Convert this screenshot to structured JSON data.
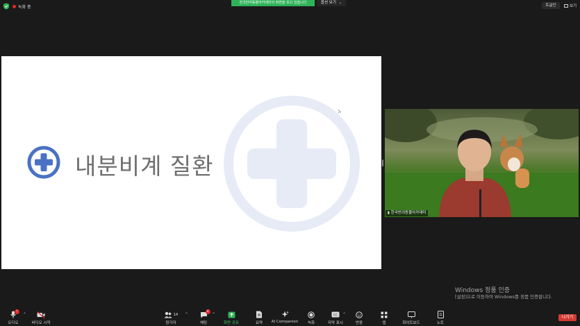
{
  "top_bar": {
    "recording_label": "녹화 중",
    "banner_text": "한국반려동물아카데미의 화면을 보고 있습니다",
    "view_options_label": "옵션 보기",
    "fullscreen_label": "토글인",
    "view_label": "보기"
  },
  "slide": {
    "title": "내분비계 질환",
    "accent_color": "#4a72c4",
    "watermark_color": "#e6ebf6"
  },
  "video": {
    "participant_name": "한국반려동물아카데미"
  },
  "windows_watermark": {
    "line1": "Windows 정품 인증",
    "line2": "[설정]으로 이동하여 Windows를 정품 인증합니다."
  },
  "toolbar": {
    "audio": "오디오",
    "video": "비디오 시작",
    "participants": "참가자",
    "participants_count": "14",
    "chat": "채팅",
    "chat_badge": "4",
    "share": "화면 공유",
    "summary": "요약",
    "ai": "AI Companion",
    "record": "녹화",
    "captions": "자막 표시",
    "reactions": "반응",
    "apps": "앱",
    "whiteboard": "화이트보드",
    "notes": "노트",
    "leave": "나가기"
  }
}
